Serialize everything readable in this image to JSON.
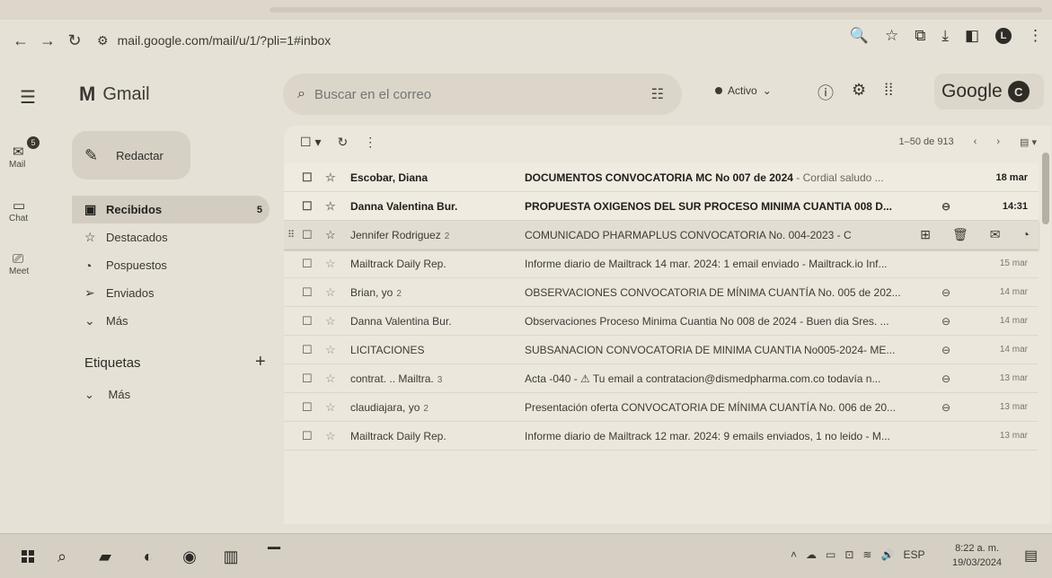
{
  "browser": {
    "url": "mail.google.com/mail/u/1/?pli=1#inbox",
    "icons": [
      "back-arrow",
      "forward-arrow",
      "reload",
      "site-settings",
      "zoom",
      "bookmark-star",
      "extensions",
      "downloads",
      "sidebar",
      "profile",
      "menu"
    ]
  },
  "header": {
    "app_name": "Gmail",
    "search_placeholder": "Buscar en el correo",
    "status": "Activo",
    "brand": "Google",
    "avatar_letter": "C"
  },
  "rail": {
    "mail_label": "Mail",
    "mail_badge": "5",
    "chat_label": "Chat",
    "meet_label": "Meet"
  },
  "sidebar": {
    "compose": "Redactar",
    "items": [
      {
        "label": "Recibidos",
        "count": "5",
        "icon": "inbox-icon"
      },
      {
        "label": "Destacados",
        "icon": "star-icon"
      },
      {
        "label": "Pospuestos",
        "icon": "clock-icon"
      },
      {
        "label": "Enviados",
        "icon": "send-icon"
      },
      {
        "label": "Más",
        "icon": "chevron-down-icon"
      }
    ],
    "labels_heading": "Etiquetas",
    "labels_more": "Más"
  },
  "toolbar": {
    "pagination": "1–50 de 913"
  },
  "emails": [
    {
      "sender": "Escobar, Diana",
      "count": "",
      "subject": "DOCUMENTOS CONVOCATORIA MC No 007 de 2024",
      "snippet": " - Cordial saludo ...",
      "date": "18 mar",
      "unread": true,
      "attachment": false
    },
    {
      "sender": "Danna Valentina Bur.",
      "count": "",
      "subject": "PROPUESTA OXIGENOS DEL SUR PROCESO MINIMA CUANTIA 008 D...",
      "snippet": "",
      "date": "14:31",
      "unread": true,
      "attachment": true
    },
    {
      "sender": "Jennifer Rodriguez",
      "count": "2",
      "subject": "COMUNICADO PHARMAPLUS CONVOCATORIA No. 004-2023 - C",
      "snippet": "",
      "date": "",
      "unread": false,
      "attachment": false,
      "hover": true
    },
    {
      "sender": "Mailtrack Daily Rep.",
      "count": "",
      "subject": "Informe diario de Mailtrack 14 mar. 2024: 1 email enviado - Mailtrack.io Inf...",
      "snippet": "",
      "date": "15 mar",
      "unread": false,
      "attachment": false
    },
    {
      "sender": "Brian, yo",
      "count": "2",
      "subject": "OBSERVACIONES CONVOCATORIA DE MÍNIMA CUANTÍA No. 005 de 202...",
      "snippet": "",
      "date": "14 mar",
      "unread": false,
      "attachment": true
    },
    {
      "sender": "Danna Valentina Bur.",
      "count": "",
      "subject": "Observaciones Proceso Minima Cuantia No 008 de 2024 - Buen dia Sres. ...",
      "snippet": "",
      "date": "14 mar",
      "unread": false,
      "attachment": true
    },
    {
      "sender": "LICITACIONES",
      "count": "",
      "subject": "SUBSANACION CONVOCATORIA DE MINIMA CUANTIA No005-2024- ME...",
      "snippet": "",
      "date": "14 mar",
      "unread": false,
      "attachment": true
    },
    {
      "sender": "contrat. .. Mailtra.",
      "count": "3",
      "subject": "Acta -040 - ⚠ Tu email a contratacion@dismedpharma.com.co todavía n...",
      "snippet": "",
      "date": "13 mar",
      "unread": false,
      "attachment": true
    },
    {
      "sender": "claudiajara, yo",
      "count": "2",
      "subject": "Presentación oferta CONVOCATORIA DE MÍNIMA CUANTÍA No. 006 de 20...",
      "snippet": "",
      "date": "13 mar",
      "unread": false,
      "attachment": true
    },
    {
      "sender": "Mailtrack Daily Rep.",
      "count": "",
      "subject": "Informe diario de Mailtrack 12 mar. 2024: 9 emails enviados, 1 no leido - M...",
      "snippet": "",
      "date": "13 mar",
      "unread": false,
      "attachment": false
    }
  ],
  "taskbar": {
    "language": "ESP",
    "time": "8:22 a. m.",
    "date": "19/03/2024"
  }
}
